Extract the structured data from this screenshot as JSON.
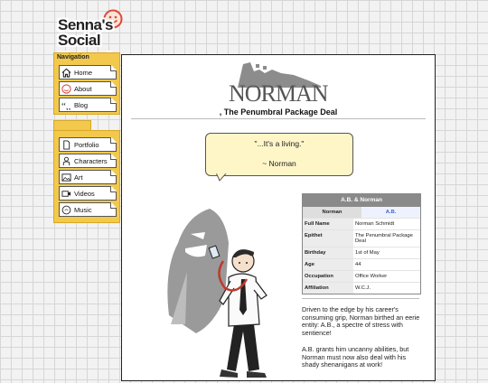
{
  "logo": {
    "line1": "Senna's",
    "line2": "Social Network"
  },
  "nav": {
    "title": "Navigation",
    "items": [
      {
        "label": "Home",
        "icon": "home-icon"
      },
      {
        "label": "About",
        "icon": "smiley-icon"
      },
      {
        "label": "Blog",
        "icon": "quote-icon"
      }
    ]
  },
  "nav2": {
    "items": [
      {
        "label": "Portfolio",
        "icon": "document-icon"
      },
      {
        "label": "Characters",
        "icon": "person-icon"
      },
      {
        "label": "Art",
        "icon": "image-icon"
      },
      {
        "label": "Videos",
        "icon": "camera-icon"
      },
      {
        "label": "Music",
        "icon": "music-icon"
      }
    ]
  },
  "page": {
    "title": "NORMAN",
    "subtitle": ", The Penumbral Package Deal",
    "quote": "\"...It's a living.\"",
    "quote_attr": "~ Norman"
  },
  "infobox": {
    "title": "A.B. & Norman",
    "tabs": [
      "Norman",
      "A.B."
    ],
    "rows": [
      {
        "key": "Full Name",
        "value": "Norman Schmidt"
      },
      {
        "key": "Epithet",
        "value": "The Penumbral Package Deal"
      },
      {
        "key": "Birthday",
        "value": "1st of May"
      },
      {
        "key": "Age",
        "value": "44"
      },
      {
        "key": "Occupation",
        "value": "Office Worker"
      },
      {
        "key": "Affiliation",
        "value": "W.C.J."
      }
    ]
  },
  "bio": {
    "p1": "Driven to the edge by his career's consuming grip, Norman birthed an eerie entity: A.B., a spectre of stress with sentience!",
    "p2": "A.B. grants him uncanny abilities, but Norman must now also deal with his shady shenanigans at work!"
  },
  "colors": {
    "nav_bg": "#f2c94c",
    "bubble_bg": "#fff6c8",
    "infobox_head": "#8a8a8a"
  }
}
